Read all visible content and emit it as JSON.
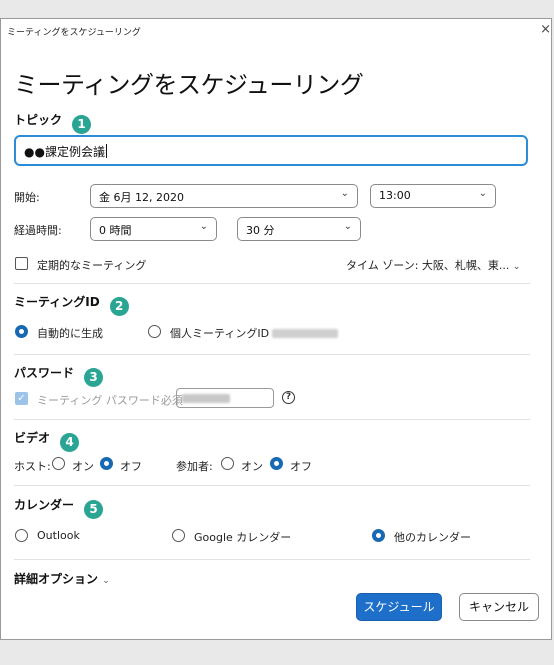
{
  "window": {
    "title": "ミーティングをスケジューリング",
    "close": "×"
  },
  "heading": "ミーティングをスケジューリング",
  "topic": {
    "label": "トピック",
    "num": "1",
    "value": "●●課定例会議"
  },
  "start": {
    "label": "開始:",
    "date": "金  6月 12, 2020",
    "time": "13:00"
  },
  "duration": {
    "label": "経過時間:",
    "hours": "0 時間",
    "minutes": "30 分"
  },
  "recurring": {
    "label": "定期的なミーティング",
    "checked": false
  },
  "timezone": "タイム ゾーン: 大阪、札幌、東...",
  "meeting_id": {
    "label": "ミーティングID",
    "num": "2",
    "auto": "自動的に生成",
    "personal": "個人ミーティングID"
  },
  "password": {
    "label": "パスワード",
    "num": "3",
    "require": "ミーティング パスワード必須"
  },
  "video": {
    "label": "ビデオ",
    "num": "4",
    "host": "ホスト:",
    "participants": "参加者:",
    "on": "オン",
    "off": "オフ"
  },
  "calendar": {
    "label": "カレンダー",
    "num": "5",
    "outlook": "Outlook",
    "google": "Google カレンダー",
    "other": "他のカレンダー"
  },
  "advanced": "詳細オプション",
  "buttons": {
    "schedule": "スケジュール",
    "cancel": "キャンセル"
  },
  "colors": {
    "accent": "#1e6fc9",
    "step": "#2aa594",
    "focus": "#2d8cd6"
  }
}
